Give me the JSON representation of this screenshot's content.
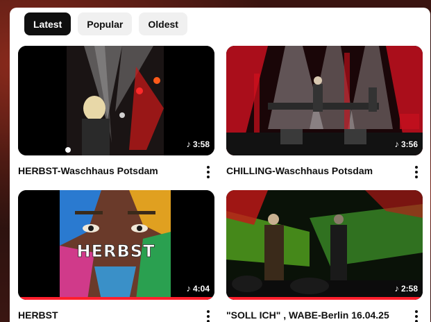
{
  "filters": {
    "chips": [
      {
        "label": "Latest",
        "active": true
      },
      {
        "label": "Popular",
        "active": false
      },
      {
        "label": "Oldest",
        "active": false
      }
    ]
  },
  "videos": [
    {
      "title": "HERBST-Waschhaus Potsdam",
      "duration": "3:58",
      "watched_fraction": 0
    },
    {
      "title": "CHILLING-Waschhaus Potsdam",
      "duration": "3:56",
      "watched_fraction": 0
    },
    {
      "title": "HERBST",
      "duration": "4:04",
      "watched_fraction": 1.0
    },
    {
      "title": "\"SOLL ICH\" , WABE-Berlin 16.04.25",
      "duration": "2:58",
      "watched_fraction": 1.0
    }
  ],
  "thumbnail_logo_text": "HERBST",
  "icons": {
    "duration": "music-note-icon",
    "menu": "more-vert-icon"
  },
  "colors": {
    "active_chip": "#0f0f0f",
    "chip": "#f0f0f0",
    "progress": "#ff1f2d"
  }
}
